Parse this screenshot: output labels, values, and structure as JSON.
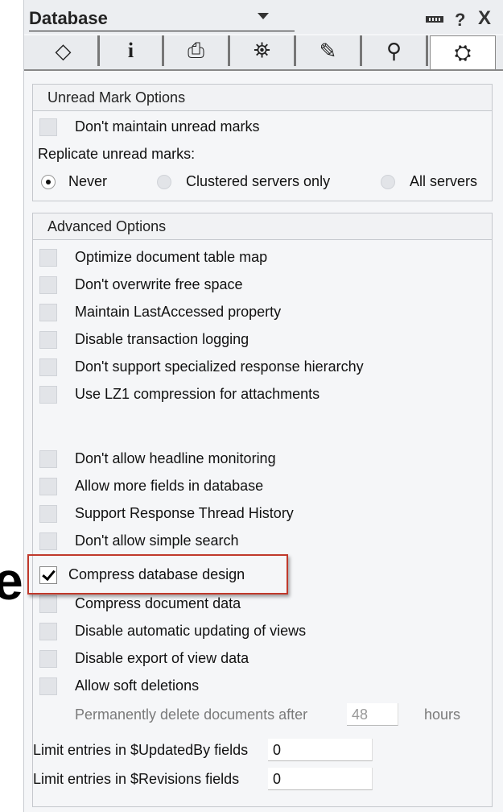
{
  "window": {
    "title": "Database",
    "pin_icon": "pin-icon",
    "help_label": "?",
    "close_label": "X"
  },
  "tabs": [
    {
      "name": "basics",
      "icon": "◇",
      "active": false
    },
    {
      "name": "info",
      "icon": "i",
      "active": false
    },
    {
      "name": "print",
      "icon": "⎙",
      "active": false
    },
    {
      "name": "design",
      "icon": "⛯",
      "active": false
    },
    {
      "name": "launch",
      "icon": "✎",
      "active": false
    },
    {
      "name": "fulltext",
      "icon": "⚲",
      "active": false
    },
    {
      "name": "advanced",
      "icon": "⛭",
      "active": true
    }
  ],
  "unread": {
    "heading": "Unread Mark Options",
    "dont_maintain": "Don't maintain unread marks",
    "replicate_label": "Replicate unread marks:",
    "options": [
      "Never",
      "Clustered servers only",
      "All servers"
    ],
    "selected": "Never"
  },
  "advanced": {
    "heading": "Advanced Options",
    "items": [
      {
        "label": "Optimize document table map",
        "checked": false
      },
      {
        "label": "Don't overwrite free space",
        "checked": false
      },
      {
        "label": "Maintain LastAccessed property",
        "checked": false
      },
      {
        "label": "Disable transaction logging",
        "checked": false
      },
      {
        "label": "Don't support specialized response hierarchy",
        "checked": false
      },
      {
        "label": "Use LZ1 compression for attachments",
        "checked": false
      },
      {
        "label": "Don't allow headline monitoring",
        "checked": false
      },
      {
        "label": "Allow more fields in database",
        "checked": false
      },
      {
        "label": "Support Response Thread History",
        "checked": false
      },
      {
        "label": "Don't allow simple search",
        "checked": false
      },
      {
        "label": "Compress database design",
        "checked": true
      },
      {
        "label": "Compress document data",
        "checked": false
      },
      {
        "label": "Disable automatic updating of views",
        "checked": false
      },
      {
        "label": "Disable export of view data",
        "checked": false
      },
      {
        "label": "Allow soft deletions",
        "checked": false
      }
    ],
    "soft_delete_prefix": "Permanently delete documents after",
    "soft_delete_value": "48",
    "soft_delete_suffix": "hours",
    "updatedby_label": "Limit entries in $UpdatedBy fields",
    "updatedby_value": "0",
    "revisions_label": "Limit entries in $Revisions fields",
    "revisions_value": "0"
  },
  "background_fragment": "e",
  "colors": {
    "highlight": "#c0392b",
    "panel_bg": "#f5f6f8"
  }
}
